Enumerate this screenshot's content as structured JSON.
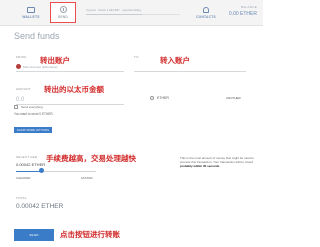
{
  "nav": {
    "wallets": {
      "label": "WALLETS",
      "icon": "wallet-icon"
    },
    "send": {
      "label": "SEND",
      "icon": "send-icon"
    },
    "contacts": {
      "label": "CONTACTS",
      "icon": "contacts-icon"
    }
  },
  "sync": {
    "text": "4 peers  ·  block 1,234,567  ·  synchronizing",
    "progress": 0.6
  },
  "balance": {
    "label": "BALANCE",
    "value": "0.00 ETHER"
  },
  "page": {
    "title": "Send funds"
  },
  "from": {
    "label": "FROM",
    "value": "Main Account (Etherbase)"
  },
  "to": {
    "label": "TO"
  },
  "amount": {
    "label": "AMOUNT",
    "value": "0.0",
    "unit_ether": "ETHER",
    "unit_other": "ANOTHER",
    "send_everything": "Send everything",
    "want_send": "You want to send 0 ETHER."
  },
  "advanced_button": "SHOW MORE OPTIONS",
  "fee": {
    "label": "SELECT FEE",
    "value": "0.00042 ETHER",
    "cheaper": "CHEAPER",
    "faster": "FASTER",
    "slider_level": 0.32,
    "note_prefix": "This is the most amount of money that might be used to process this transaction. Your transaction will be mined ",
    "note_bold": "probably within 30 seconds",
    "note_suffix": "."
  },
  "total": {
    "label": "TOTAL",
    "value": "0.00042 ETHER"
  },
  "send_button": "SEND",
  "annotations": {
    "from_account": "转出账户",
    "to_account": "转入账户",
    "amount": "转出的以太币金额",
    "fee": "手续费越高，交易处理越快",
    "send": "点击按钮进行转账"
  },
  "colors": {
    "accent": "#3a7cc8",
    "annotation": "#d22b2b",
    "nav_highlight": "#e94f4f"
  }
}
